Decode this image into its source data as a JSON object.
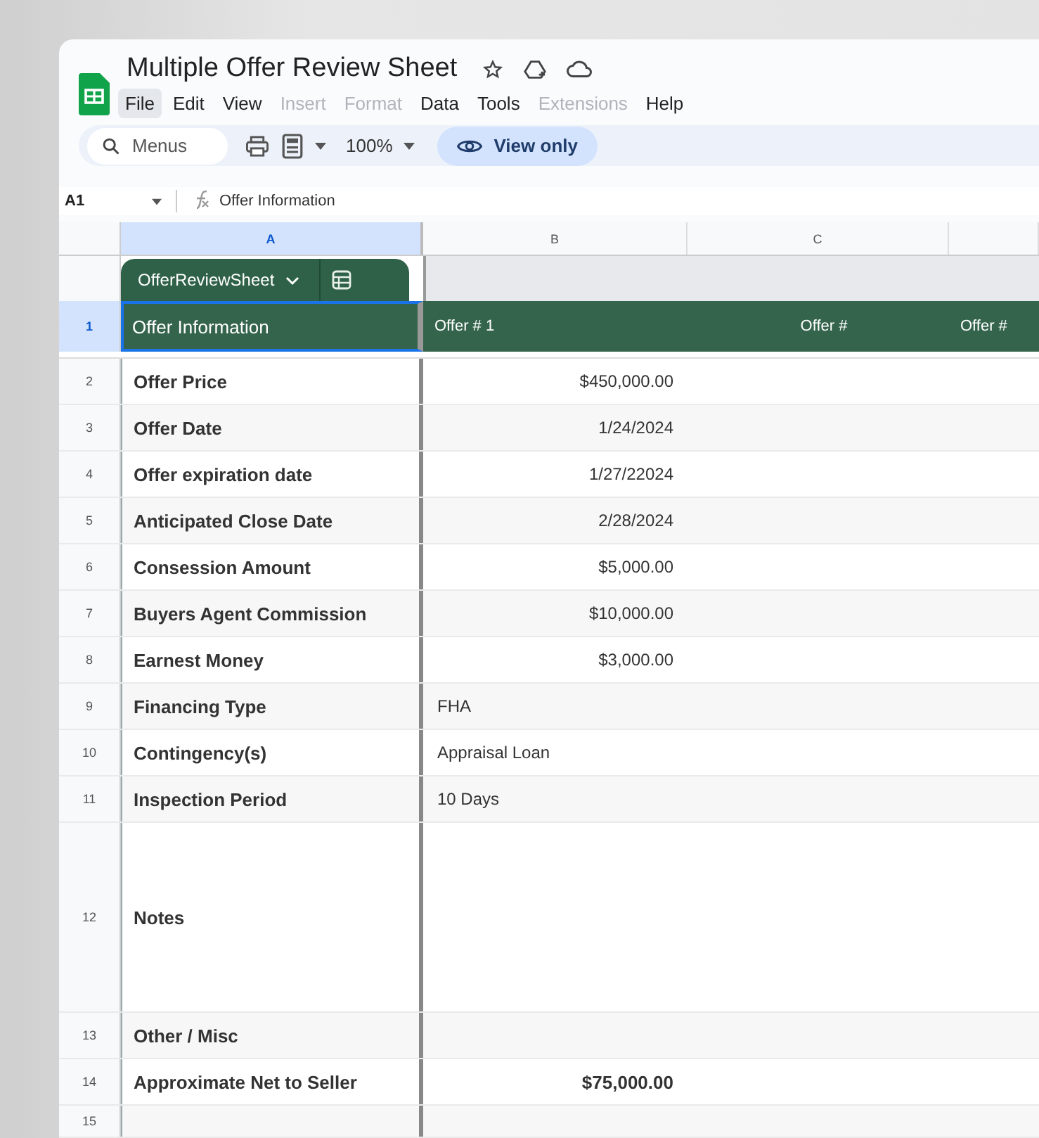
{
  "document": {
    "title": "Multiple Offer Review Sheet"
  },
  "menu": [
    {
      "label": "File",
      "selected": true,
      "disabled": false
    },
    {
      "label": "Edit",
      "selected": false,
      "disabled": false
    },
    {
      "label": "View",
      "selected": false,
      "disabled": false
    },
    {
      "label": "Insert",
      "selected": false,
      "disabled": true
    },
    {
      "label": "Format",
      "selected": false,
      "disabled": true
    },
    {
      "label": "Data",
      "selected": false,
      "disabled": false
    },
    {
      "label": "Tools",
      "selected": false,
      "disabled": false
    },
    {
      "label": "Extensions",
      "selected": false,
      "disabled": true
    },
    {
      "label": "Help",
      "selected": false,
      "disabled": false
    }
  ],
  "toolbar": {
    "search_placeholder": "Menus",
    "zoom": "100%",
    "mode_button": "View only"
  },
  "formula_bar": {
    "cell": "A1",
    "value": "Offer Information"
  },
  "columns": [
    {
      "label": "A",
      "selected": true
    },
    {
      "label": "B",
      "selected": false
    },
    {
      "label": "C",
      "selected": false
    }
  ],
  "table_tab": {
    "name": "OfferReviewSheet"
  },
  "header_row": {
    "number": "1",
    "selected": true,
    "cells": [
      "Offer Information",
      "Offer # 1",
      "Offer #",
      "Offer #"
    ]
  },
  "rows": [
    {
      "number": "2",
      "label": "Offer Price",
      "value": "$450,000.00",
      "kind": "number"
    },
    {
      "number": "3",
      "label": "Offer Date",
      "value": "1/24/2024",
      "kind": "number"
    },
    {
      "number": "4",
      "label": "Offer expiration date",
      "value": "1/27/22024",
      "kind": "number"
    },
    {
      "number": "5",
      "label": "Anticipated Close Date",
      "value": "2/28/2024",
      "kind": "number"
    },
    {
      "number": "6",
      "label": "Consession Amount",
      "value": "$5,000.00",
      "kind": "number"
    },
    {
      "number": "7",
      "label": "Buyers Agent Commission",
      "value": "$10,000.00",
      "kind": "number"
    },
    {
      "number": "8",
      "label": "Earnest Money",
      "value": "$3,000.00",
      "kind": "number"
    },
    {
      "number": "9",
      "label": "Financing Type",
      "value": "FHA",
      "kind": "text"
    },
    {
      "number": "10",
      "label": "Contingency(s)",
      "value": "Appraisal Loan",
      "kind": "text"
    },
    {
      "number": "11",
      "label": "Inspection Period",
      "value": "10 Days",
      "kind": "text"
    },
    {
      "number": "12",
      "label": "Notes",
      "kind": "notes"
    },
    {
      "number": "13",
      "label": "Other / Misc",
      "kind": "text"
    },
    {
      "number": "14",
      "label": "Approximate Net to Seller",
      "value": "$75,000.00",
      "kind": "total"
    },
    {
      "number": "15",
      "kind": "partial"
    }
  ]
}
